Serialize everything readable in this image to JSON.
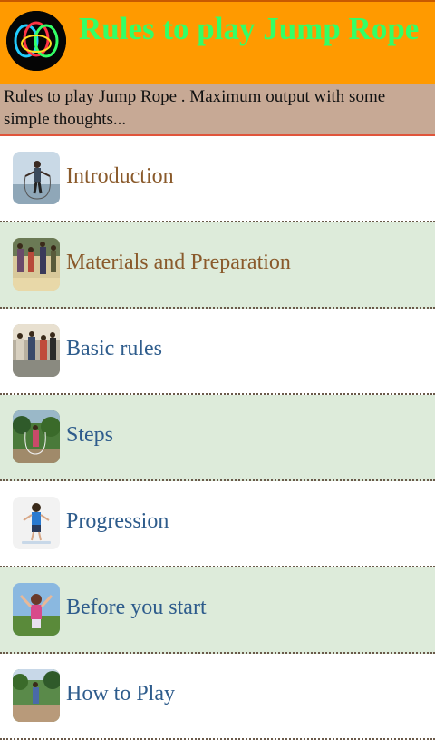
{
  "header": {
    "title": "Rules to play Jump Rope",
    "icon": "colorful-rings-app-icon",
    "background_color": "#FF9A00",
    "title_color": "#33FF66"
  },
  "subtitle": {
    "text": "Rules to play Jump Rope . Maximum output with some simple thoughts..."
  },
  "menu": {
    "items": [
      {
        "label": "Introduction",
        "thumbnail": "person-jumping-rope-photo"
      },
      {
        "label": "Materials and Preparation",
        "thumbnail": "children-playing-photo"
      },
      {
        "label": "Basic rules",
        "thumbnail": "group-jumping-photo"
      },
      {
        "label": "Steps",
        "thumbnail": "outdoor-jump-photo"
      },
      {
        "label": "Progression",
        "thumbnail": "boy-jumping-photo"
      },
      {
        "label": "Before you start",
        "thumbnail": "girl-jumping-photo"
      },
      {
        "label": "How to Play",
        "thumbnail": "park-jump-photo"
      }
    ]
  }
}
